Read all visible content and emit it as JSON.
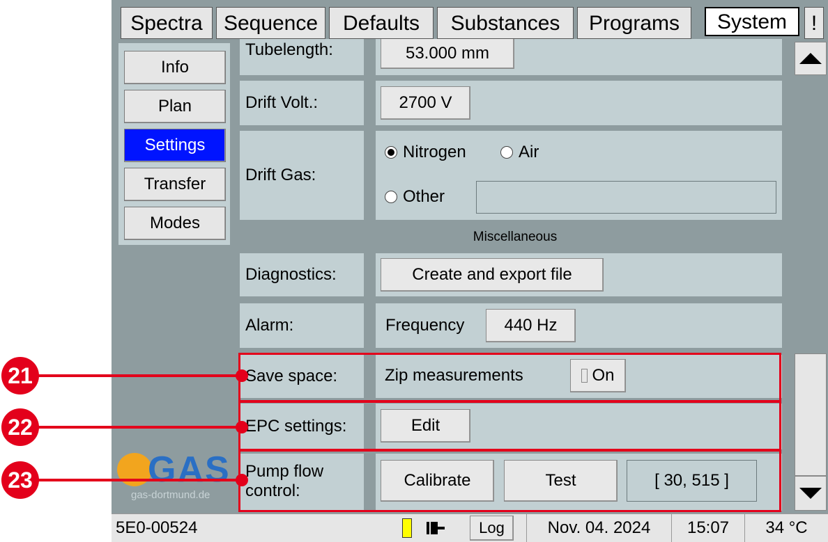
{
  "tabs": [
    {
      "label": "Spectra"
    },
    {
      "label": "Sequence"
    },
    {
      "label": "Defaults"
    },
    {
      "label": "Substances"
    },
    {
      "label": "Programs"
    },
    {
      "label": "System",
      "active": true
    },
    {
      "label": "!"
    }
  ],
  "sidebar": {
    "items": [
      {
        "label": "Info"
      },
      {
        "label": "Plan"
      },
      {
        "label": "Settings",
        "active": true
      },
      {
        "label": "Transfer"
      },
      {
        "label": "Modes"
      }
    ],
    "logo_text": "GAS",
    "logo_url": "gas-dortmund.de"
  },
  "settings": {
    "tubelength": {
      "label": "Tubelength:",
      "value": "53.000 mm"
    },
    "drift_volt": {
      "label": "Drift Volt.:",
      "value": "2700 V"
    },
    "drift_gas": {
      "label": "Drift Gas:",
      "options": [
        "Nitrogen",
        "Air",
        "Other"
      ],
      "selected": "Nitrogen",
      "other_value": ""
    },
    "section_title": "Miscellaneous",
    "diagnostics": {
      "label": "Diagnostics:",
      "button": "Create and export file"
    },
    "alarm": {
      "label": "Alarm:",
      "freq_label": "Frequency",
      "freq_value": "440 Hz"
    },
    "save_space": {
      "label": "Save space:",
      "option": "Zip measurements",
      "toggle": "On"
    },
    "epc": {
      "label": "EPC settings:",
      "button": "Edit"
    },
    "pump": {
      "label_line1": "Pump flow",
      "label_line2": "control:",
      "calibrate": "Calibrate",
      "test": "Test",
      "value": "[ 30, 515 ]"
    }
  },
  "status": {
    "device_id": "5E0-00524",
    "log_label": "Log",
    "date": "Nov. 04. 2024",
    "time": "15:07",
    "temp": "34 °C"
  },
  "callouts": [
    "21",
    "22",
    "23"
  ],
  "colors": {
    "highlight": "#e3001b",
    "active_nav": "#0014ff",
    "panel": "#c2d0d3",
    "frame": "#8e9c9f"
  }
}
